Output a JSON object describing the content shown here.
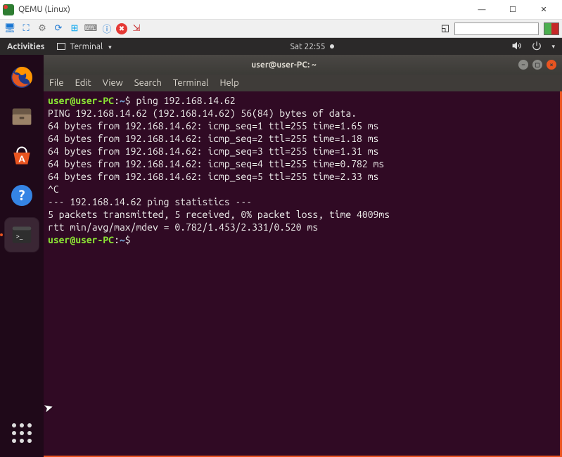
{
  "window": {
    "title": "QEMU (Linux)"
  },
  "qemu_toolbar": {
    "icons": [
      {
        "name": "monitor-icon",
        "glyph": "🖥",
        "color": "#1976d2"
      },
      {
        "name": "fullscreen-icon",
        "glyph": "⛶",
        "color": "#1976d2"
      },
      {
        "name": "settings-icon",
        "glyph": "⚙",
        "color": "#777"
      },
      {
        "name": "refresh-icon",
        "glyph": "⟳",
        "color": "#1976d2"
      },
      {
        "name": "windows-icon",
        "glyph": "⊞",
        "color": "#00a4ef"
      },
      {
        "name": "keyboard-icon",
        "glyph": "⌨",
        "color": "#666"
      },
      {
        "name": "info-icon",
        "glyph": "ⓘ",
        "color": "#1976d2"
      },
      {
        "name": "close-icon",
        "glyph": "✖",
        "color": "#fff",
        "bg": "#e53935"
      },
      {
        "name": "export-icon",
        "glyph": "⇲",
        "color": "#c62828"
      }
    ],
    "right_icon": {
      "name": "scale-icon",
      "glyph": "◱",
      "color": "#666"
    }
  },
  "ubuntu_topbar": {
    "activities": "Activities",
    "app_name": "Terminal",
    "clock": "Sat 22:55"
  },
  "dock": {
    "items": [
      {
        "name": "firefox"
      },
      {
        "name": "files"
      },
      {
        "name": "software"
      },
      {
        "name": "help"
      },
      {
        "name": "terminal",
        "active": true
      }
    ]
  },
  "terminal": {
    "title": "user@user-PC: ~",
    "menu": [
      "File",
      "Edit",
      "View",
      "Search",
      "Terminal",
      "Help"
    ],
    "prompt_user": "user@user-PC",
    "prompt_sep": ":",
    "prompt_path": "~",
    "prompt_char": "$",
    "command": "ping 192.168.14.62",
    "lines": [
      "PING 192.168.14.62 (192.168.14.62) 56(84) bytes of data.",
      "64 bytes from 192.168.14.62: icmp_seq=1 ttl=255 time=1.65 ms",
      "64 bytes from 192.168.14.62: icmp_seq=2 ttl=255 time=1.18 ms",
      "64 bytes from 192.168.14.62: icmp_seq=3 ttl=255 time=1.31 ms",
      "64 bytes from 192.168.14.62: icmp_seq=4 ttl=255 time=0.782 ms",
      "64 bytes from 192.168.14.62: icmp_seq=5 ttl=255 time=2.33 ms",
      "^C",
      "--- 192.168.14.62 ping statistics ---",
      "5 packets transmitted, 5 received, 0% packet loss, time 4009ms",
      "rtt min/avg/max/mdev = 0.782/1.453/2.331/0.520 ms"
    ]
  }
}
